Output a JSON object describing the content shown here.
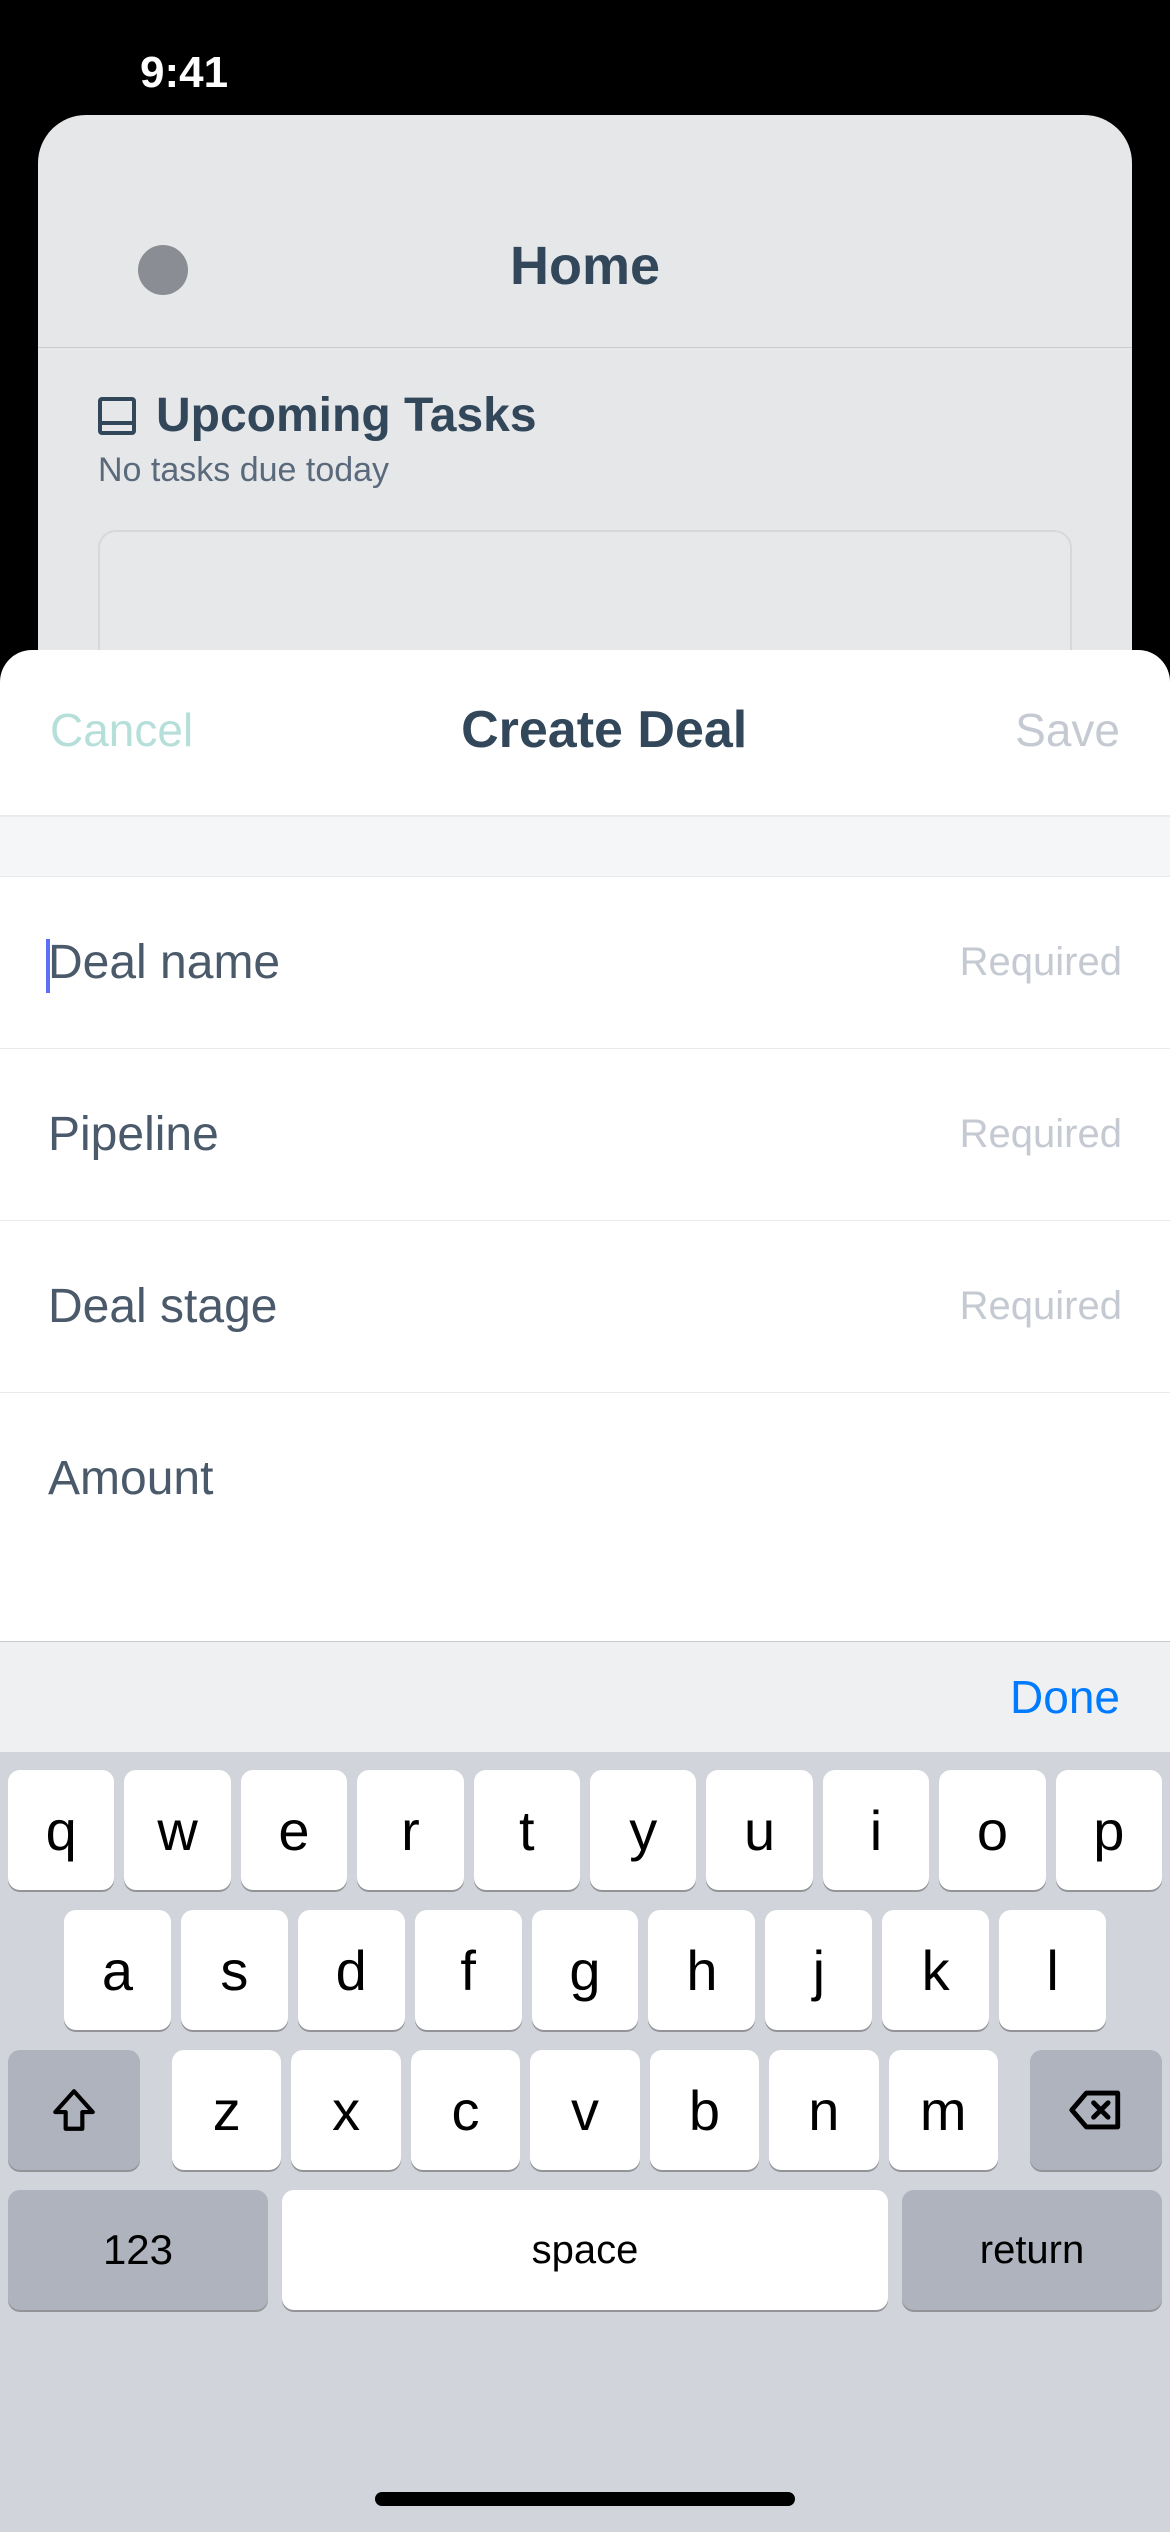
{
  "status": {
    "time": "9:41"
  },
  "home": {
    "title": "Home",
    "tasks_heading": "Upcoming Tasks",
    "tasks_subtitle": "No tasks due today"
  },
  "sheet": {
    "cancel": "Cancel",
    "title": "Create Deal",
    "save": "Save",
    "fields": [
      {
        "label": "Deal name",
        "hint": "Required"
      },
      {
        "label": "Pipeline",
        "hint": "Required"
      },
      {
        "label": "Deal stage",
        "hint": "Required"
      },
      {
        "label": "Amount",
        "hint": ""
      }
    ]
  },
  "keyboard": {
    "done": "Done",
    "row1": [
      "q",
      "w",
      "e",
      "r",
      "t",
      "y",
      "u",
      "i",
      "o",
      "p"
    ],
    "row2": [
      "a",
      "s",
      "d",
      "f",
      "g",
      "h",
      "j",
      "k",
      "l"
    ],
    "row3": [
      "z",
      "x",
      "c",
      "v",
      "b",
      "n",
      "m"
    ],
    "k123": "123",
    "space": "space",
    "ret": "return"
  }
}
